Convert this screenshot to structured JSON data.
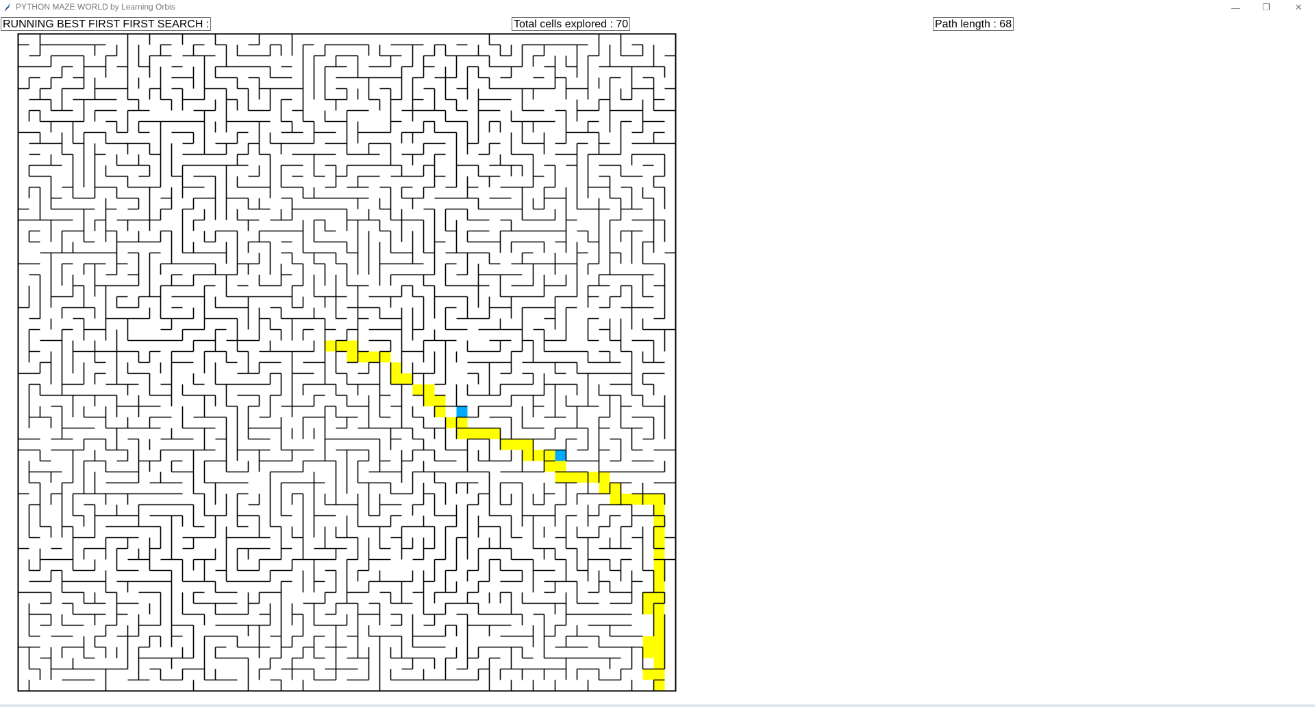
{
  "window": {
    "title": "PYTHON MAZE WORLD by Learning Orbis",
    "controls": {
      "minimize": "—",
      "maximize": "❐",
      "close": "✕"
    }
  },
  "status": {
    "algorithm": "RUNNING BEST FIRST FIRST SEARCH :",
    "explored": "Total cells explored : 70",
    "path_length": "Path length : 68"
  },
  "maze": {
    "rows": 60,
    "cols": 60,
    "wall_color": "#000000",
    "path_color": "#ffff00",
    "explored_color": "#00aaff",
    "path": [
      [
        29,
        29
      ],
      [
        29,
        30
      ],
      [
        29,
        31
      ],
      [
        30,
        31
      ],
      [
        30,
        32
      ],
      [
        30,
        33
      ],
      [
        30,
        34
      ],
      [
        31,
        35
      ],
      [
        32,
        35
      ],
      [
        32,
        36
      ],
      [
        33,
        37
      ],
      [
        33,
        38
      ],
      [
        34,
        38
      ],
      [
        34,
        39
      ],
      [
        35,
        39
      ],
      [
        36,
        40
      ],
      [
        36,
        41
      ],
      [
        37,
        41
      ],
      [
        37,
        42
      ],
      [
        37,
        43
      ],
      [
        37,
        44
      ],
      [
        38,
        45
      ],
      [
        38,
        46
      ],
      [
        38,
        47
      ],
      [
        39,
        47
      ],
      [
        39,
        48
      ],
      [
        39,
        49
      ],
      [
        40,
        49
      ],
      [
        40,
        50
      ],
      [
        41,
        50
      ],
      [
        41,
        51
      ],
      [
        41,
        52
      ],
      [
        41,
        53
      ],
      [
        41,
        54
      ],
      [
        42,
        54
      ],
      [
        42,
        55
      ],
      [
        43,
        55
      ],
      [
        43,
        56
      ],
      [
        43,
        57
      ],
      [
        43,
        58
      ],
      [
        43,
        59
      ],
      [
        44,
        59
      ],
      [
        45,
        59
      ],
      [
        46,
        59
      ],
      [
        47,
        59
      ],
      [
        48,
        59
      ],
      [
        49,
        59
      ],
      [
        50,
        59
      ],
      [
        51,
        59
      ],
      [
        52,
        58
      ],
      [
        52,
        59
      ],
      [
        53,
        58
      ],
      [
        53,
        59
      ],
      [
        54,
        59
      ],
      [
        55,
        59
      ],
      [
        56,
        58
      ],
      [
        56,
        59
      ],
      [
        57,
        58
      ],
      [
        57,
        59
      ],
      [
        58,
        59
      ],
      [
        59,
        58
      ],
      [
        59,
        59
      ],
      [
        60,
        59
      ]
    ],
    "explored": [
      [
        35,
        41
      ],
      [
        39,
        50
      ]
    ]
  }
}
